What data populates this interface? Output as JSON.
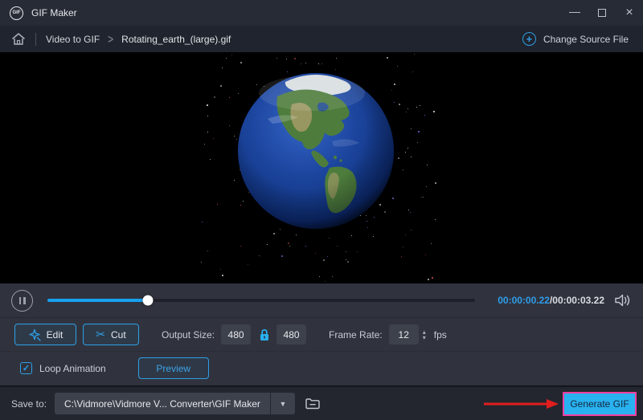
{
  "window": {
    "title": "GIF Maker",
    "logo": "GIF"
  },
  "icons": {
    "minimize": "—",
    "close": "×",
    "chevron": ">",
    "plus": "+",
    "dropdown": "▼",
    "spin_up": "▴",
    "spin_down": "▾",
    "check": "✓",
    "scissors": "✂"
  },
  "breadcrumb": {
    "section": "Video to GIF",
    "file": "Rotating_earth_(large).gif"
  },
  "source": {
    "change_label": "Change Source File"
  },
  "player": {
    "current": "00:00:00.22",
    "total": "/00:00:03.22",
    "progress_percent": 23.5
  },
  "toolbar": {
    "edit_label": "Edit",
    "cut_label": "Cut",
    "output_size_label": "Output Size:",
    "output_width": "480",
    "output_height": "480",
    "frame_rate_label": "Frame Rate:",
    "frame_rate_value": "12",
    "frame_rate_unit": "fps"
  },
  "options": {
    "loop_label": "Loop Animation",
    "loop_checked": true,
    "preview_label": "Preview"
  },
  "footer": {
    "save_to_label": "Save to:",
    "save_path": "C:\\Vidmore\\Vidmore V... Converter\\GIF Maker",
    "generate_label": "Generate GIF"
  },
  "colors": {
    "accent": "#2e9fe6",
    "slider_fill": "#18a0f0",
    "timestamp_current": "#2f9ce8",
    "generate_bg": "#29b2f0",
    "annotation_arrow": "#e11d1d",
    "annotation_border": "#ef3fa0",
    "panel_bg": "#30333e",
    "footer_bg": "#23262f",
    "titlebar_bg": "#272b36",
    "breadcrumb_bg": "#20242e"
  }
}
